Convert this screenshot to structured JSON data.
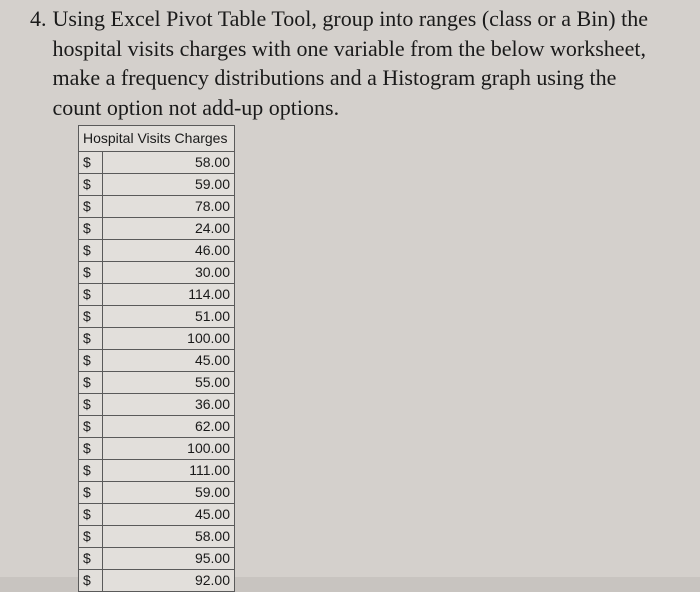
{
  "question": {
    "number": "4.",
    "text": "Using Excel Pivot Table Tool, group into ranges (class or a Bin) the hospital visits charges with one variable from the below worksheet, make a frequency distributions and a Histogram graph using the count option not add-up options."
  },
  "table": {
    "header": "Hospital Visits Charges",
    "currency_symbol": "$",
    "rows": [
      "58.00",
      "59.00",
      "78.00",
      "24.00",
      "46.00",
      "30.00",
      "114.00",
      "51.00",
      "100.00",
      "45.00",
      "55.00",
      "36.00",
      "62.00",
      "100.00",
      "111.00",
      "59.00",
      "45.00",
      "58.00",
      "95.00",
      "92.00"
    ]
  }
}
